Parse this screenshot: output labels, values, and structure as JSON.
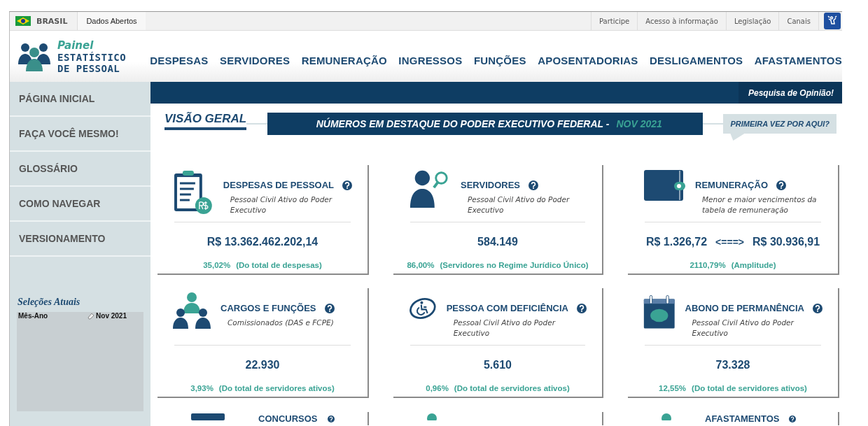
{
  "top_bar": {
    "country": "BRASIL",
    "open_data": "Dados Abertos",
    "links": [
      "Participe",
      "Acesso à informação",
      "Legislação",
      "Canais"
    ]
  },
  "header": {
    "logo": {
      "line1": "Painel",
      "line2": "ESTATÍSTICO",
      "line3": "DE PESSOAL"
    },
    "nav": [
      "DESPESAS",
      "SERVIDORES",
      "REMUNERAÇÃO",
      "INGRESSOS",
      "FUNÇÕES",
      "APOSENTADORIAS",
      "DESLIGAMENTOS",
      "AFASTAMENTOS"
    ]
  },
  "banner": {
    "survey_link": "Pesquisa de Opinião!"
  },
  "sidebar": {
    "items": [
      "PÁGINA INICIAL",
      "FAÇA VOCÊ MESMO!",
      "GLOSSÁRIO",
      "COMO NAVEGAR",
      "VERSIONAMENTO"
    ],
    "selections": {
      "title": "Seleções Atuais",
      "field": "Mês-Ano",
      "value": "Nov 2021"
    }
  },
  "overview": {
    "title": "VISÃO GERAL",
    "headline": "NÚMEROS EM DESTAQUE DO PODER EXECUTIVO FEDERAL -",
    "headline_date": "NOV 2021",
    "help_bubble": "PRIMEIRA VEZ POR AQUI?"
  },
  "cards": [
    {
      "kind": "single",
      "title": "DESPESAS DE PESSOAL",
      "subtitle": "Pessoal Civil Ativo do Poder Executivo",
      "value": "R$ 13.362.462.202,14",
      "percent": "35,02%",
      "note": "(Do total de despesas)"
    },
    {
      "kind": "single",
      "title": "SERVIDORES",
      "subtitle": "Pessoal Civil Ativo do Poder Executivo",
      "value": "584.149",
      "percent": "86,00%",
      "note": "(Servidores no Regime Jurídico Único)"
    },
    {
      "kind": "range",
      "title": "REMUNERAÇÃO",
      "subtitle": "Menor e maior vencimentos da tabela de remuneração",
      "value_min": "R$ 1.326,72",
      "arrow": "<===>",
      "value_max": "R$ 30.936,91",
      "percent": "2110,79%",
      "note": "(Amplitude)"
    },
    {
      "kind": "single",
      "title": "CARGOS E FUNÇÕES",
      "subtitle": "Comissionados (DAS e FCPE)",
      "value": "22.930",
      "percent": "3,93%",
      "note": "(Do total de servidores ativos)"
    },
    {
      "kind": "single",
      "title": "PESSOA COM DEFICIÊNCIA",
      "subtitle": "Pessoal Civil Ativo do Poder Executivo",
      "value": "5.610",
      "percent": "0,96%",
      "note": "(Do total de servidores ativos)"
    },
    {
      "kind": "single",
      "title": "ABONO DE PERMANÊNCIA",
      "subtitle": "Pessoal Civil Ativo do Poder Executivo",
      "value": "73.328",
      "percent": "12,55%",
      "note": "(Do total de servidores ativos)"
    },
    {
      "kind": "partial",
      "title": "CONCURSOS"
    },
    {
      "kind": "partial"
    },
    {
      "kind": "partial",
      "title": "AFASTAMENTOS"
    }
  ]
}
